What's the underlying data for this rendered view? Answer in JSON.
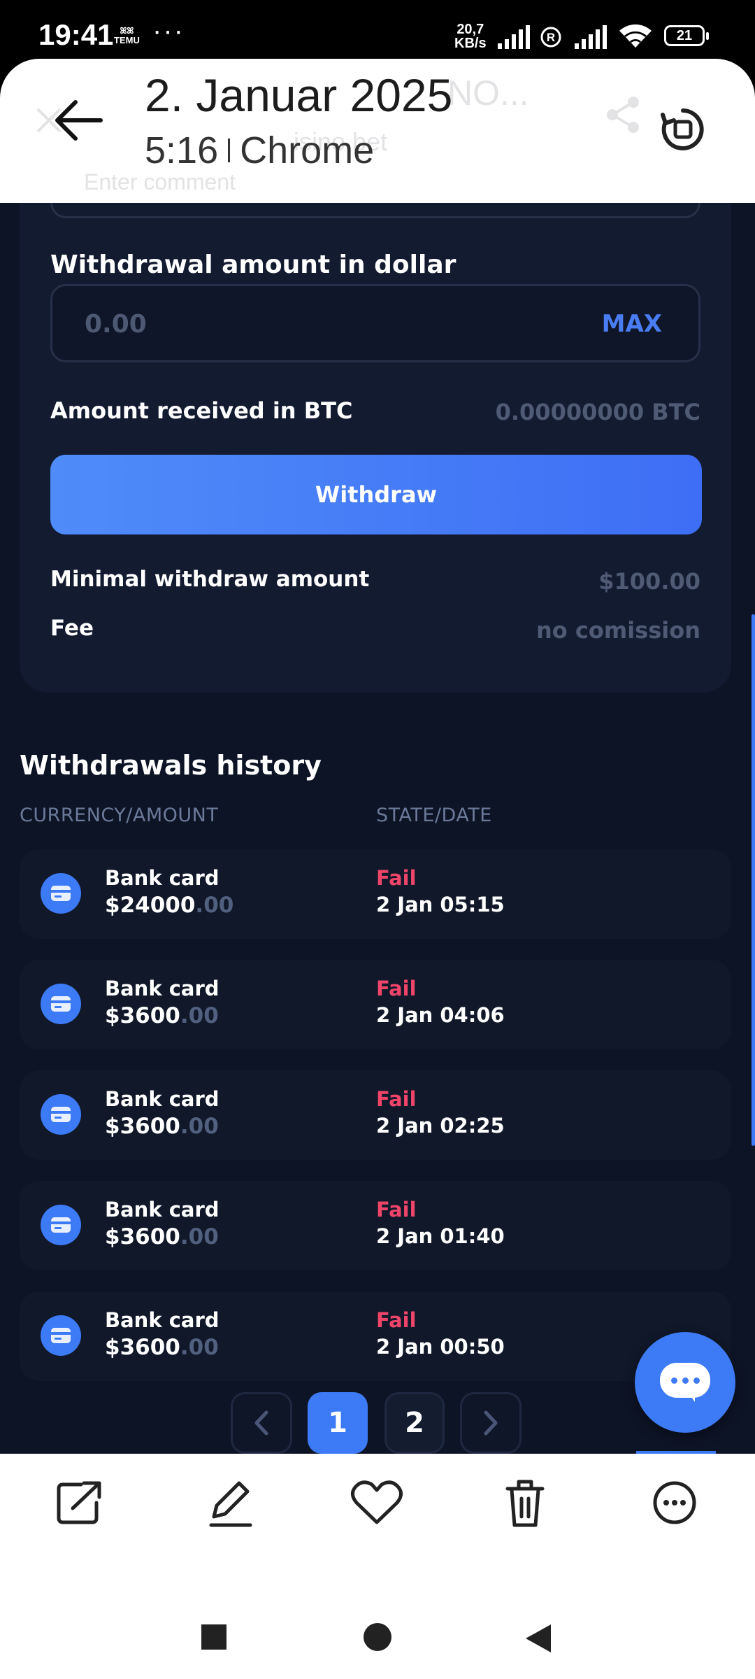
{
  "status_bar": {
    "time": "19:41",
    "notif_label": "TEMU",
    "more_dots": "···",
    "net_speed_value": "20,7",
    "net_speed_unit": "KB/s",
    "battery": "21",
    "icons": [
      "signal-icon",
      "registered-icon",
      "signal-icon",
      "wifi-icon",
      "battery-icon"
    ]
  },
  "info_sheet": {
    "date": "2. Januar 2025",
    "time": "5:16",
    "app": "Chrome",
    "bg_title_fragment": "NO...",
    "bg_url_fragment": "isino.bet",
    "bg_comment_placeholder": "Enter comment"
  },
  "form": {
    "amount_label": "Withdrawal amount in dollar",
    "amount_placeholder": "0.00",
    "max_label": "MAX",
    "received_label": "Amount received in BTC",
    "received_value": "0.00000000 BTC",
    "withdraw_button": "Withdraw",
    "min_label": "Minimal withdraw amount",
    "min_value": "$100.00",
    "fee_label": "Fee",
    "fee_value": "no comission"
  },
  "history": {
    "title": "Withdrawals history",
    "col_amount": "CURRENCY/AMOUNT",
    "col_state": "STATE/DATE",
    "rows": [
      {
        "method": "Bank card",
        "amount_whole": "$24000",
        "amount_cents": ".00",
        "state": "Fail",
        "date": "2 Jan 05:15"
      },
      {
        "method": "Bank card",
        "amount_whole": "$3600",
        "amount_cents": ".00",
        "state": "Fail",
        "date": "2 Jan 04:06"
      },
      {
        "method": "Bank card",
        "amount_whole": "$3600",
        "amount_cents": ".00",
        "state": "Fail",
        "date": "2 Jan 02:25"
      },
      {
        "method": "Bank card",
        "amount_whole": "$3600",
        "amount_cents": ".00",
        "state": "Fail",
        "date": "2 Jan 01:40"
      },
      {
        "method": "Bank card",
        "amount_whole": "$3600",
        "amount_cents": ".00",
        "state": "Fail",
        "date": "2 Jan 00:50"
      }
    ]
  },
  "pagination": {
    "pages": [
      "1",
      "2"
    ],
    "current": "1"
  },
  "toolbar": {
    "items": [
      "share-icon",
      "edit-icon",
      "favorite-icon",
      "delete-icon",
      "more-icon"
    ]
  },
  "colors": {
    "background": "#0d1426",
    "card": "#131b31",
    "accent": "#3d7af6",
    "fail": "#f0456a",
    "muted": "#4f5a75"
  }
}
